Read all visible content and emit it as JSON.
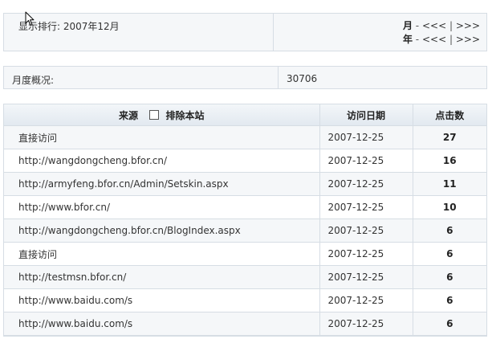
{
  "ranking": {
    "title": "显示排行: 2007年12月",
    "month_label": "月",
    "year_label": "年",
    "dash": "-",
    "prev": "<<<",
    "pipe": "|",
    "next": ">>>"
  },
  "overview": {
    "label": "月度概况:",
    "value": "30706"
  },
  "table": {
    "headers": {
      "source": "来源",
      "exclude_label": "排除本站",
      "date": "访问日期",
      "clicks": "点击数"
    },
    "rows": [
      {
        "source": "直接访问",
        "date": "2007-12-25",
        "clicks": "27"
      },
      {
        "source": "http://wangdongcheng.bfor.cn/",
        "date": "2007-12-25",
        "clicks": "16"
      },
      {
        "source": "http://armyfeng.bfor.cn/Admin/Setskin.aspx",
        "date": "2007-12-25",
        "clicks": "11"
      },
      {
        "source": "http://www.bfor.cn/",
        "date": "2007-12-25",
        "clicks": "10"
      },
      {
        "source": "http://wangdongcheng.bfor.cn/BlogIndex.aspx",
        "date": "2007-12-25",
        "clicks": "6"
      },
      {
        "source": "直接访问",
        "date": "2007-12-25",
        "clicks": "6"
      },
      {
        "source": "http://testmsn.bfor.cn/",
        "date": "2007-12-25",
        "clicks": "6"
      },
      {
        "source": "http://www.baidu.com/s",
        "date": "2007-12-25",
        "clicks": "6"
      },
      {
        "source": "http://www.baidu.com/s",
        "date": "2007-12-25",
        "clicks": "6"
      }
    ]
  },
  "colors": {
    "border": "#d6dde4",
    "row_alt": "#f5f7f9",
    "header_bg": "#e2e9f0"
  },
  "icons": {
    "cursor": "arrow-pointer-icon",
    "exclude_checkbox": "checkbox-unchecked-icon"
  }
}
